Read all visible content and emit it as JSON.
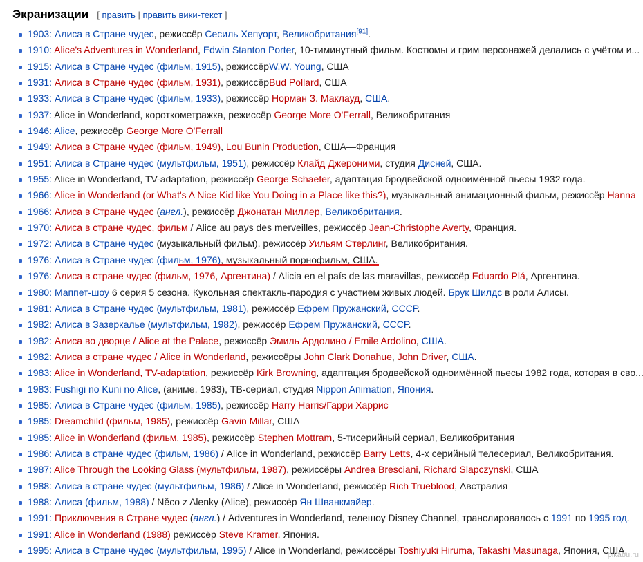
{
  "heading": {
    "title": "Экранизации",
    "bracket_open": "[",
    "edit_label": "править",
    "separator": "|",
    "edit_wiki_label": "править вики-текст",
    "bracket_close": "]"
  },
  "items": [
    [
      [
        "b",
        "1903: "
      ],
      [
        "b",
        "Алиса в Стране чудес"
      ],
      [
        "t",
        ", режиссёр "
      ],
      [
        "b",
        "Сесиль Хепуорт"
      ],
      [
        "t",
        ", "
      ],
      [
        "b",
        "Великобритания"
      ],
      [
        "sup",
        "[91]"
      ],
      [
        "t",
        "."
      ]
    ],
    [
      [
        "b",
        "1910: "
      ],
      [
        "r",
        "Alice's Adventures in Wonderland"
      ],
      [
        "t",
        ", "
      ],
      [
        "b",
        "Edwin Stanton Porter"
      ],
      [
        "t",
        ", 10-тиминутный фильм. Костюмы и грим персонажей делались с учётом и..."
      ]
    ],
    [
      [
        "b",
        "1915: "
      ],
      [
        "b",
        "Алиса в Стране чудес (фильм, 1915)"
      ],
      [
        "t",
        ", режиссёр"
      ],
      [
        "b",
        "W.W. Young"
      ],
      [
        "t",
        ", США"
      ]
    ],
    [
      [
        "b",
        "1931: "
      ],
      [
        "r",
        "Алиса в Стране чудес (фильм, 1931)"
      ],
      [
        "t",
        ", режиссёр"
      ],
      [
        "r",
        "Bud Pollard"
      ],
      [
        "t",
        ", США"
      ]
    ],
    [
      [
        "b",
        "1933: "
      ],
      [
        "b",
        "Алиса в Стране чудес (фильм, 1933)"
      ],
      [
        "t",
        ", режиссёр "
      ],
      [
        "r",
        "Норман З. Маклауд"
      ],
      [
        "t",
        ", "
      ],
      [
        "b",
        "США"
      ],
      [
        "t",
        "."
      ]
    ],
    [
      [
        "b",
        "1937: "
      ],
      [
        "t",
        "Alice in Wonderland, короткометражка, режиссёр "
      ],
      [
        "r",
        "George More O'Ferrall"
      ],
      [
        "t",
        ", Великобритания"
      ]
    ],
    [
      [
        "b",
        "1946: "
      ],
      [
        "b",
        "Alice"
      ],
      [
        "t",
        ", режиссёр "
      ],
      [
        "r",
        "George More O'Ferrall"
      ]
    ],
    [
      [
        "b",
        "1949: "
      ],
      [
        "r",
        "Алиса в Стране чудес (фильм, 1949)"
      ],
      [
        "t",
        ", "
      ],
      [
        "r",
        "Lou Bunin Production"
      ],
      [
        "t",
        ", США—Франция"
      ]
    ],
    [
      [
        "b",
        "1951: "
      ],
      [
        "b",
        "Алиса в Стране чудес (мультфильм, 1951)"
      ],
      [
        "t",
        ", режиссёр "
      ],
      [
        "r",
        "Клайд Джероними"
      ],
      [
        "t",
        ", студия "
      ],
      [
        "b",
        "Дисней"
      ],
      [
        "t",
        ", США."
      ]
    ],
    [
      [
        "b",
        "1955: "
      ],
      [
        "t",
        "Alice in Wonderland, TV-adaptation, режиссёр "
      ],
      [
        "r",
        "George Schaefer"
      ],
      [
        "t",
        ", адаптация бродвейской одноимённой пьесы 1932 года."
      ]
    ],
    [
      [
        "b",
        "1966: "
      ],
      [
        "r",
        "Alice in Wonderland (or What's A Nice Kid like You Doing in a Place like this?)"
      ],
      [
        "t",
        ", музыкальный анимационный фильм, режиссёр "
      ],
      [
        "r",
        "Hanna"
      ]
    ],
    [
      [
        "b",
        "1966: "
      ],
      [
        "r",
        "Алиса в Стране чудес"
      ],
      [
        "t",
        " ("
      ],
      [
        "ib",
        "англ."
      ],
      [
        "t",
        "), режиссёр "
      ],
      [
        "r",
        "Джонатан Миллер"
      ],
      [
        "t",
        ", "
      ],
      [
        "b",
        "Великобритания"
      ],
      [
        "t",
        "."
      ]
    ],
    [
      [
        "b",
        "1970: "
      ],
      [
        "r",
        "Алиса в стране чудес, фильм"
      ],
      [
        "t",
        " / Alice au pays des merveilles, режиссёр "
      ],
      [
        "r",
        "Jean-Christophe Averty"
      ],
      [
        "t",
        ", Франция."
      ]
    ],
    [
      [
        "b",
        "1972: "
      ],
      [
        "b",
        "Алиса в Стране чудес"
      ],
      [
        "t",
        " (музыкальный фильм), режиссёр "
      ],
      [
        "r",
        "Уильям Стерлинг"
      ],
      [
        "t",
        ", Великобритания."
      ]
    ],
    [
      [
        "b",
        "1976: "
      ],
      [
        "b",
        "Алиса в Стране чудес (фильм, 1976)"
      ],
      [
        "t",
        ", музыкальный порнофильм, США."
      ]
    ],
    [
      [
        "b",
        "1976: "
      ],
      [
        "r",
        "Алиса в стране чудес (фильм, 1976, Аргентина)"
      ],
      [
        "t",
        " / Alicia en el país de las maravillas, режиссёр "
      ],
      [
        "r",
        "Eduardo Plá"
      ],
      [
        "t",
        ", Аргентина."
      ]
    ],
    [
      [
        "b",
        "1980: "
      ],
      [
        "b",
        "Маппет-шоу"
      ],
      [
        "t",
        " 6 серия 5 сезона. Кукольная спектакль-пародия с участием живых людей. "
      ],
      [
        "b",
        "Брук Шилдс"
      ],
      [
        "t",
        " в роли Алисы."
      ]
    ],
    [
      [
        "b",
        "1981: "
      ],
      [
        "b",
        "Алиса в Стране чудес (мультфильм, 1981)"
      ],
      [
        "t",
        ", режиссёр "
      ],
      [
        "b",
        "Ефрем Пружанский"
      ],
      [
        "t",
        ", "
      ],
      [
        "b",
        "СССР"
      ],
      [
        "t",
        "."
      ]
    ],
    [
      [
        "b",
        "1982: "
      ],
      [
        "b",
        "Алиса в Зазеркалье (мультфильм, 1982)"
      ],
      [
        "t",
        ", режиссёр "
      ],
      [
        "b",
        "Ефрем Пружанский"
      ],
      [
        "t",
        ", "
      ],
      [
        "b",
        "СССР"
      ],
      [
        "t",
        "."
      ]
    ],
    [
      [
        "b",
        "1982: "
      ],
      [
        "r",
        "Алиса во дворце / Alice at the Palace"
      ],
      [
        "t",
        ", режиссёр "
      ],
      [
        "r",
        "Эмиль Ардолино / Emile Ardolino"
      ],
      [
        "t",
        ", "
      ],
      [
        "b",
        "США"
      ],
      [
        "t",
        "."
      ]
    ],
    [
      [
        "b",
        "1982: "
      ],
      [
        "r",
        "Алиса в стране чудес / Alice in Wonderland"
      ],
      [
        "t",
        ", режиссёры "
      ],
      [
        "r",
        "John Clark Donahue"
      ],
      [
        "t",
        ", "
      ],
      [
        "r",
        "John Driver"
      ],
      [
        "t",
        ", "
      ],
      [
        "b",
        "США"
      ],
      [
        "t",
        "."
      ]
    ],
    [
      [
        "b",
        "1983: "
      ],
      [
        "r",
        "Alice in Wonderland, TV-adaptation"
      ],
      [
        "t",
        ", режиссёр "
      ],
      [
        "r",
        "Kirk Browning"
      ],
      [
        "t",
        ", адаптация бродвейской одноимённой пьесы 1982 года, которая в сво..."
      ]
    ],
    [
      [
        "b",
        "1983: "
      ],
      [
        "b",
        "Fushigi no Kuni no Alice"
      ],
      [
        "t",
        ", (аниме, 1983), ТВ-сериал, студия "
      ],
      [
        "b",
        "Nippon Animation"
      ],
      [
        "t",
        ", "
      ],
      [
        "b",
        "Япония"
      ],
      [
        "t",
        "."
      ]
    ],
    [
      [
        "b",
        "1985: "
      ],
      [
        "b",
        "Алиса в Стране чудес (фильм, 1985)"
      ],
      [
        "t",
        ", режиссёр "
      ],
      [
        "r",
        "Harry Harris/Гарри Харрис"
      ]
    ],
    [
      [
        "b",
        "1985: "
      ],
      [
        "r",
        "Dreamchild (фильм, 1985)"
      ],
      [
        "t",
        ", режиссёр "
      ],
      [
        "r",
        "Gavin Millar"
      ],
      [
        "t",
        ", США"
      ]
    ],
    [
      [
        "b",
        "1985: "
      ],
      [
        "r",
        "Alice in Wonderland (фильм, 1985)"
      ],
      [
        "t",
        ", режиссёр "
      ],
      [
        "r",
        "Stephen Mottram"
      ],
      [
        "t",
        ", 5-тисерийный сериал, Великобритания"
      ]
    ],
    [
      [
        "b",
        "1986: "
      ],
      [
        "b",
        "Алиса в стране чудес (фильм, 1986)"
      ],
      [
        "t",
        " / Alice in Wonderland, режиссёр "
      ],
      [
        "r",
        "Barry Letts"
      ],
      [
        "t",
        ", 4-х серийный телесериал, Великобритания."
      ]
    ],
    [
      [
        "b",
        "1987: "
      ],
      [
        "r",
        "Alice Through the Looking Glass (мультфильм, 1987)"
      ],
      [
        "t",
        ", режиссёры "
      ],
      [
        "r",
        "Andrea Bresciani"
      ],
      [
        "t",
        ", "
      ],
      [
        "r",
        "Richard Slapczynski"
      ],
      [
        "t",
        ", США"
      ]
    ],
    [
      [
        "b",
        "1988: "
      ],
      [
        "b",
        "Алиса в стране чудес (мультфильм, 1986)"
      ],
      [
        "t",
        " / Alice in Wonderland, режиссёр "
      ],
      [
        "r",
        "Rich Trueblood"
      ],
      [
        "t",
        ", Австралия"
      ]
    ],
    [
      [
        "b",
        "1988: "
      ],
      [
        "b",
        "Алиса (фильм, 1988)"
      ],
      [
        "t",
        " / Něco z Alenky (Alice), режиссёр "
      ],
      [
        "b",
        "Ян Шванкмайер"
      ],
      [
        "t",
        "."
      ]
    ],
    [
      [
        "b",
        "1991: "
      ],
      [
        "r",
        "Приключения в Стране чудес"
      ],
      [
        "t",
        " ("
      ],
      [
        "ib",
        "англ."
      ],
      [
        "t",
        ") / Adventures in Wonderland, телешоу Disney Channel, транслировалось с "
      ],
      [
        "b",
        "1991"
      ],
      [
        "t",
        " по "
      ],
      [
        "b",
        "1995 год"
      ],
      [
        "t",
        "."
      ]
    ],
    [
      [
        "b",
        "1991: "
      ],
      [
        "r",
        "Alice in Wonderland (1988)"
      ],
      [
        "t",
        " режиссёр "
      ],
      [
        "r",
        "Steve Kramer"
      ],
      [
        "t",
        ", Япония."
      ]
    ],
    [
      [
        "b",
        "1995: "
      ],
      [
        "b",
        "Алиса в Стране чудес (мультфильм, 1995)"
      ],
      [
        "t",
        " / Alice in Wonderland, режиссёры "
      ],
      [
        "r",
        "Toshiyuki Hiruma"
      ],
      [
        "t",
        ", "
      ],
      [
        "r",
        "Takashi Masunaga"
      ],
      [
        "t",
        ", Япония, США."
      ]
    ]
  ],
  "watermark": "pikabu.ru",
  "colors": {
    "link": "#0645ad",
    "redlink": "#ba0000",
    "text": "#222222",
    "underline": "#e01b1b"
  }
}
